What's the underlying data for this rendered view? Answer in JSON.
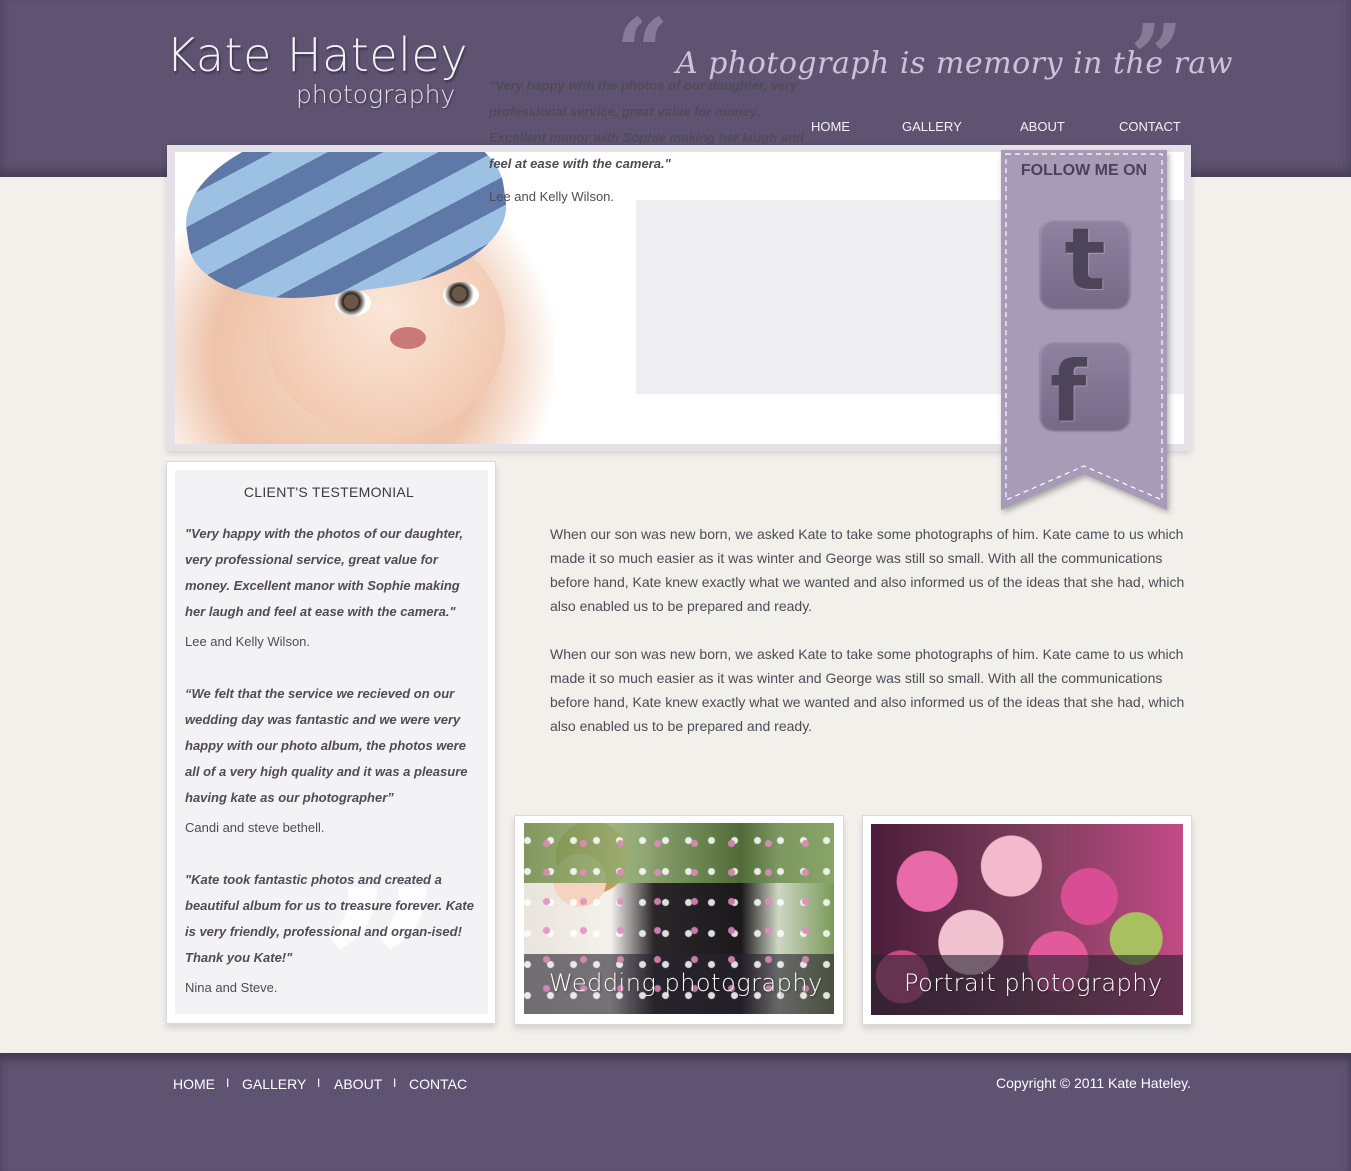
{
  "brand": {
    "name": "Kate Hateley",
    "subtitle": "photography"
  },
  "tagline": "A photograph is memory in the raw",
  "nav": {
    "home": "HOME",
    "gallery": "GALLERY",
    "about": "ABOUT",
    "contact": "CONTACT"
  },
  "hero": {
    "quote": "\"Very happy with the photos of our daughter, very professional service, great value for money. Excellent manor with Sophie making her laugh and feel at ease with the camera.\"",
    "author": "Lee and Kelly Wilson."
  },
  "social": {
    "title": "FOLLOW ME ON",
    "twitter_icon": "twitter-icon",
    "facebook_icon": "facebook-icon"
  },
  "testimonials": {
    "heading": "CLIENT'S TESTEMONIAL",
    "items": [
      {
        "quote": "\"Very happy with the photos of our daughter, very professional service, great value for money. Excellent manor with Sophie making her laugh and feel at ease with the camera.\"",
        "author": "Lee and Kelly Wilson."
      },
      {
        "quote": "“We felt that the service we recieved on our wedding day was fantastic and we were very happy with our photo album, the photos were all of a very high quality and it was a pleasure having kate as our photographer”",
        "author": "Candi and steve bethell."
      },
      {
        "quote": "\"Kate took fantastic photos and created a beautiful album for us to treasure forever. Kate is very friendly, professional and organ-ised! Thank you Kate!\"",
        "author": "Nina and Steve."
      }
    ]
  },
  "body": {
    "paragraphs": [
      "When our son was new born, we asked Kate to take some photographs of him. Kate came to us which made it so much easier as it was winter and George was still so small. With all the communications before hand, Kate knew exactly what we wanted and also informed us of the ideas that she had, which also enabled us to be prepared and ready.",
      "When our son was new born, we asked Kate to take some photographs of him. Kate came to us which made it so much easier as it was winter and George was still so small. With all the communications before hand, Kate knew exactly what we wanted and also informed us of the ideas that she had, which also enabled us to be prepared and ready."
    ]
  },
  "cards": {
    "wedding": "Wedding photography",
    "portrait": "Portrait photography"
  },
  "footer": {
    "links": [
      "HOME",
      "GALLERY",
      "ABOUT",
      "CONTAC"
    ],
    "separator": "I",
    "copyright": "Copyright © 2011 Kate Hateley."
  },
  "colors": {
    "header": "#5c5271",
    "accent": "#a89bb8",
    "page": "#f2f0eb"
  }
}
